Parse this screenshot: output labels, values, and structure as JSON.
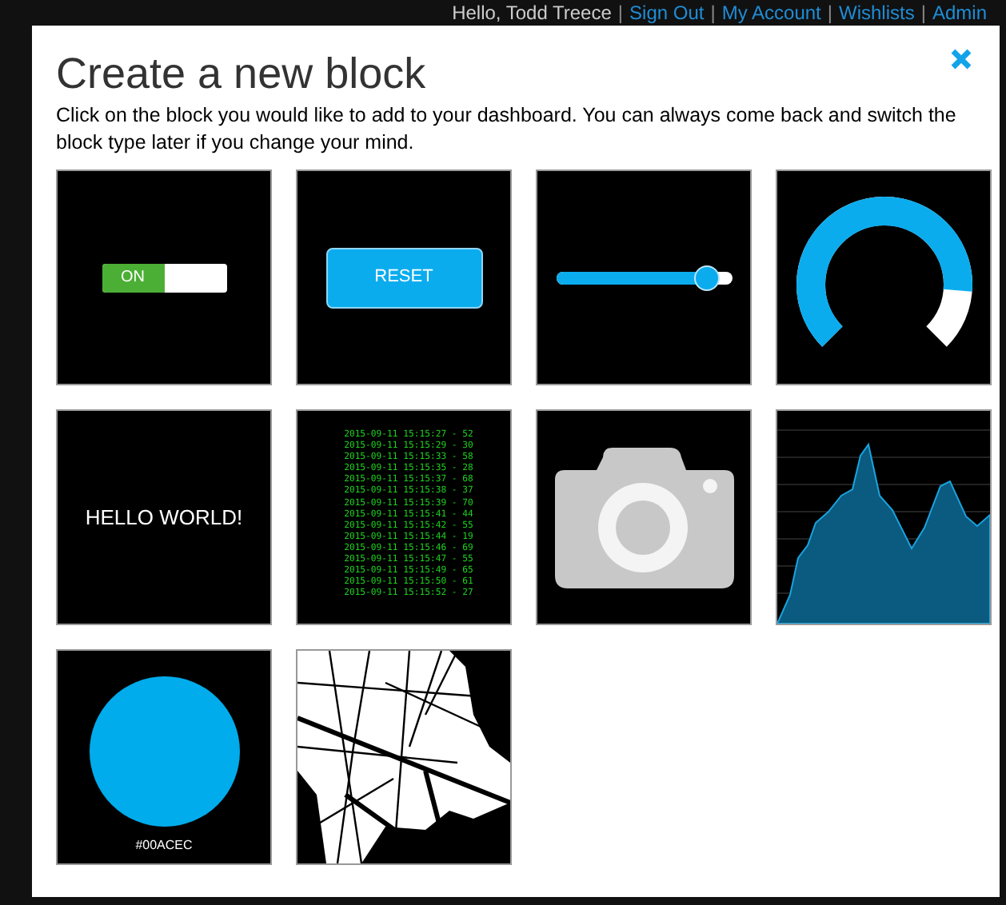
{
  "header": [
    {
      "kind": "text",
      "text": "Hello, Todd Treece"
    },
    {
      "kind": "sep",
      "text": "|"
    },
    {
      "kind": "link",
      "text": "Sign Out"
    },
    {
      "kind": "sep",
      "text": "|"
    },
    {
      "kind": "link",
      "text": "My Account"
    },
    {
      "kind": "sep",
      "text": "|"
    },
    {
      "kind": "link",
      "text": "Wishlists"
    },
    {
      "kind": "sep",
      "text": "|"
    },
    {
      "kind": "link",
      "text": "Admin"
    }
  ],
  "dialog": {
    "title": "Create a new block",
    "description": "Click on the block you would like to add to your dashboard. You can always come back and switch the block type later if you change your mind.",
    "blocks": [
      {
        "kind": "toggle",
        "label": "ON",
        "on": true
      },
      {
        "kind": "button",
        "label": "RESET"
      },
      {
        "kind": "slider",
        "level": 0.86
      },
      {
        "kind": "gauge"
      },
      {
        "kind": "text",
        "text": "HELLO WORLD!"
      },
      {
        "kind": "log",
        "lines": [
          "2015-09-11 15:15:27 - 52",
          "2015-09-11 15:15:29 - 30",
          "2015-09-11 15:15:33 - 58",
          "2015-09-11 15:15:35 - 28",
          "2015-09-11 15:15:37 - 68",
          "2015-09-11 15:15:38 - 37",
          "2015-09-11 15:15:39 - 70",
          "2015-09-11 15:15:41 - 44",
          "2015-09-11 15:15:42 - 55",
          "2015-09-11 15:15:44 - 19",
          "2015-09-11 15:15:46 - 69",
          "2015-09-11 15:15:47 - 55",
          "2015-09-11 15:15:49 - 65",
          "2015-09-11 15:15:50 - 61",
          "2015-09-11 15:15:52 - 27"
        ]
      },
      {
        "kind": "camera"
      },
      {
        "kind": "chart"
      },
      {
        "kind": "color",
        "label": "#00ACEC",
        "color": "#00acec"
      },
      {
        "kind": "map"
      }
    ]
  }
}
